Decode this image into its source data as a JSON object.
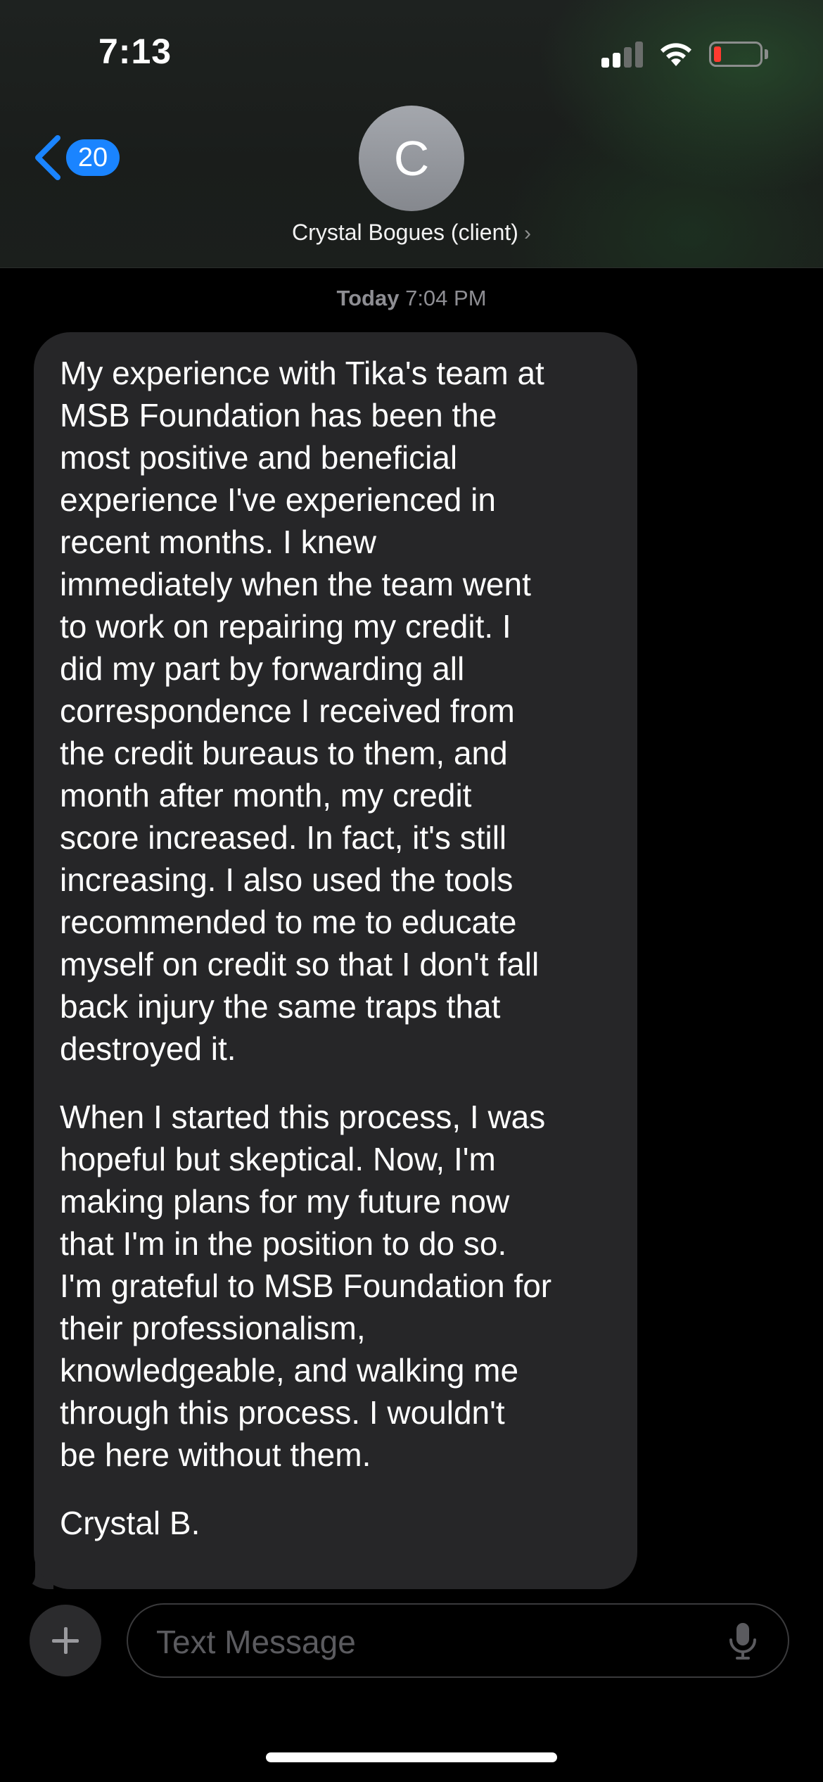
{
  "status_bar": {
    "time": "7:13",
    "signal_icon": "cellular-signal-icon",
    "wifi_icon": "wifi-icon",
    "battery_icon": "battery-low-icon",
    "battery_level_color": "#ff3b30"
  },
  "nav": {
    "back_icon": "chevron-left-icon",
    "unread_count": "20",
    "accent_color": "#1a84ff"
  },
  "contact": {
    "avatar_initial": "C",
    "name": "Crystal Bogues (client)",
    "chevron": "›"
  },
  "conversation": {
    "timestamp_day": "Today",
    "timestamp_time": "7:04 PM",
    "message": {
      "paragraphs": [
        "My experience with Tika's team at\nMSB Foundation has been the\nmost positive and beneficial\nexperience I've experienced in\nrecent months. I knew\nimmediately when the team went\nto work on repairing my credit. I\ndid my part by forwarding  all\ncorrespondence I received from\nthe credit bureaus to them,  and\nmonth after month, my credit\nscore increased. In fact, it's still\nincreasing.  I also used the tools\nrecommended to me to educate\nmyself on credit so that I don't fall\nback injury the same traps that\ndestroyed it.",
        "When I started this process, I was\nhopeful but skeptical. Now, I'm\nmaking plans for my future now\nthat I'm in the position to do so.\nI'm grateful to MSB Foundation for\ntheir professionalism,\nknowledgeable, and walking me\nthrough this process. I  wouldn't\nbe here without them.",
        "Crystal B."
      ]
    }
  },
  "composer": {
    "plus_icon": "plus-icon",
    "placeholder": "Text Message",
    "mic_icon": "microphone-icon"
  }
}
